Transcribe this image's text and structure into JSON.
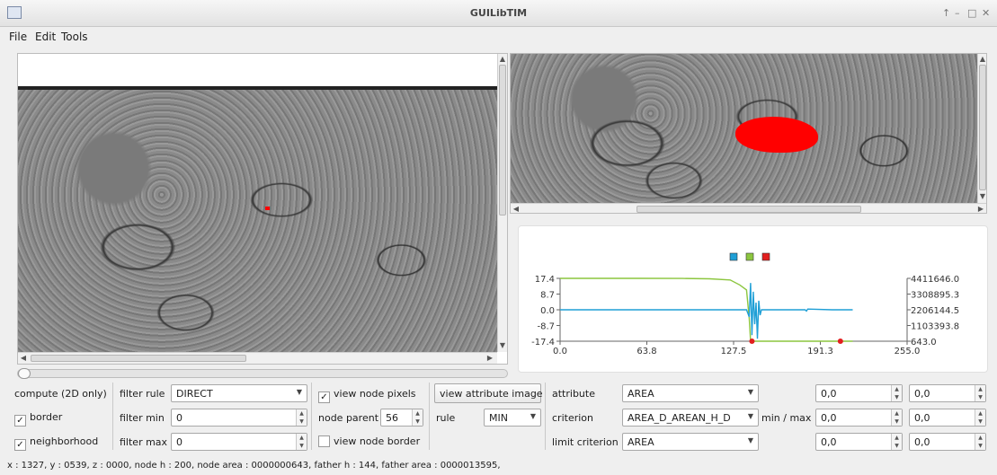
{
  "window": {
    "title": "GUILibTIM",
    "controls": [
      "↑",
      "–",
      "□",
      "✕"
    ]
  },
  "menu": [
    {
      "label": "File"
    },
    {
      "label": "Edit"
    },
    {
      "label": "Tools"
    }
  ],
  "controls": {
    "compute_label": "compute (2D only)",
    "border": {
      "label": "border",
      "checked": true
    },
    "neighborhood": {
      "label": "neighborhood",
      "checked": true
    },
    "filter_rule": {
      "label": "filter rule",
      "value": "DIRECT"
    },
    "filter_min": {
      "label": "filter min",
      "value": "0"
    },
    "filter_max": {
      "label": "filter max",
      "value": "0"
    },
    "view_node_pixels": {
      "label": "view node pixels",
      "checked": true
    },
    "node_parent": {
      "label": "node parent",
      "value": "56"
    },
    "view_node_border": {
      "label": "view node border",
      "checked": false
    },
    "view_attribute_image": "view attribute image",
    "rule": {
      "label": "rule",
      "value": "MIN"
    },
    "attribute": {
      "label": "attribute",
      "value": "AREA"
    },
    "criterion": {
      "label": "criterion",
      "value": "AREA_D_AREAN_H_D"
    },
    "limit_criterion": {
      "label": "limit criterion",
      "value": "AREA"
    },
    "minmax_label": "min / max",
    "ranges": [
      [
        "0,0",
        "0,0"
      ],
      [
        "0,0",
        "0,0"
      ],
      [
        "0,0",
        "0,0"
      ]
    ]
  },
  "status": "x : 1327, y : 0539, z : 0000, node h : 200, node area : 0000000643, father h : 144, father area : 0000013595,",
  "colors": {
    "series1": "#1f9fd6",
    "series2": "#8cc63f",
    "series3": "#e21f1f",
    "highlight": "#ff0000"
  },
  "chart_data": {
    "type": "line",
    "legend_markers": [
      "#1f9fd6",
      "#8cc63f",
      "#e21f1f"
    ],
    "xlim": [
      0.0,
      255.0
    ],
    "x_ticks": [
      "0.0",
      "63.8",
      "127.5",
      "191.3",
      "255.0"
    ],
    "ylim_left": [
      -17.4,
      17.4
    ],
    "y_ticks_left": [
      "17.4",
      "8.7",
      "0.0",
      "-8.7",
      "-17.4"
    ],
    "ylim_right": [
      643.0,
      4411646.0
    ],
    "y_ticks_right": [
      "4411646.0",
      "3308895.3",
      "2206144.5",
      "1103393.8",
      "643.0"
    ],
    "series": [
      {
        "axis": "right",
        "color": "#8cc63f",
        "x": [
          0,
          30,
          60,
          90,
          110,
          125,
          132,
          137,
          139,
          140,
          142,
          150,
          200,
          215
        ],
        "y": [
          4411646,
          4411646,
          4411000,
          4405000,
          4380000,
          4300000,
          3950000,
          3600000,
          1600000,
          20000,
          643,
          643,
          643,
          643
        ]
      },
      {
        "axis": "left",
        "color": "#1f9fd6",
        "x": [
          0,
          60,
          120,
          137,
          139,
          140,
          141,
          142,
          143,
          144,
          145,
          146,
          147,
          148,
          150,
          170,
          180,
          181,
          182,
          200,
          215
        ],
        "y": [
          0,
          0,
          0,
          0,
          -4,
          14.8,
          -14,
          10,
          -8,
          4,
          -16,
          5,
          -3,
          0,
          0,
          0,
          0,
          -0.7,
          0.4,
          0,
          0
        ]
      },
      {
        "axis": "left",
        "color": "#e21f1f",
        "type": "scatter",
        "x": [
          141,
          206
        ],
        "y": [
          -17.4,
          -17.4
        ]
      }
    ]
  }
}
